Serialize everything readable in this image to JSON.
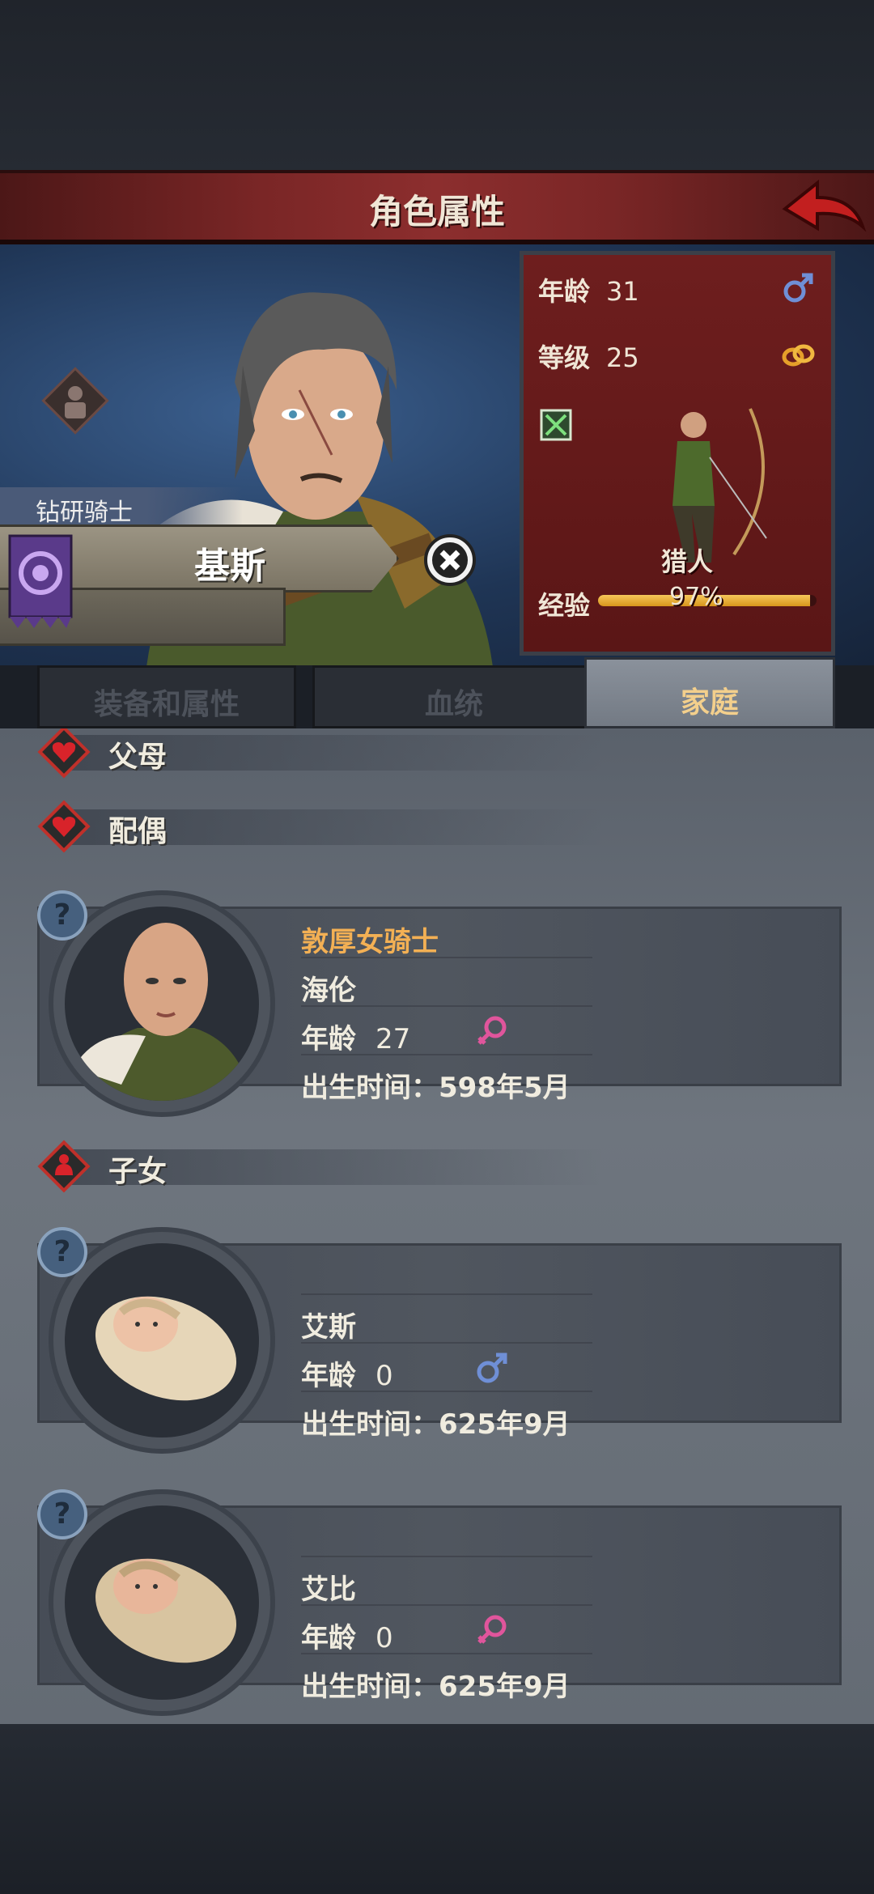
{
  "title": "角色属性",
  "hero": {
    "class_label": "钻研骑士",
    "name": "基斯"
  },
  "stats": {
    "age_label": "年龄",
    "age_value": "31",
    "level_label": "等级",
    "level_value": "25",
    "job_label": "猎人",
    "exp_label": "经验",
    "exp_value": "97%",
    "exp_fraction": 0.97
  },
  "tabs": [
    "装备和属性",
    "血统",
    "家庭"
  ],
  "active_tab": "家庭",
  "sections": {
    "parents": "父母",
    "spouse": "配偶",
    "children": "子女"
  },
  "spouse": {
    "title": "敦厚女骑士",
    "name": "海伦",
    "age_label": "年龄",
    "age_value": "27",
    "gender": "female",
    "birth": "出生时间：598年5月"
  },
  "children": [
    {
      "name": "艾斯",
      "age_label": "年龄",
      "age_value": "0",
      "gender": "male",
      "birth": "出生时间：625年9月"
    },
    {
      "name": "艾比",
      "age_label": "年龄",
      "age_value": "0",
      "gender": "female",
      "birth": "出生时间：625年9月"
    }
  ],
  "colors": {
    "male": "#6f8fd6",
    "female": "#e0559c",
    "accent": "#f3b054",
    "banner": "#7a2626"
  }
}
